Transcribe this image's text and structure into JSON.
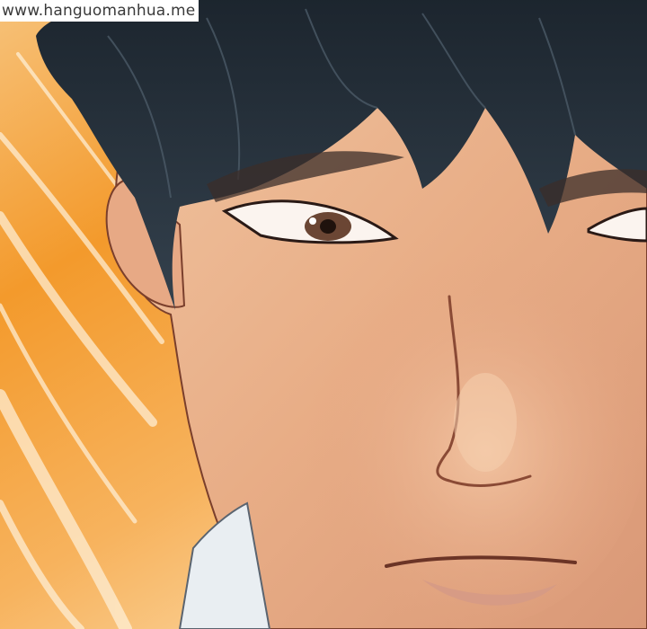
{
  "watermark": {
    "text": "www.hanguomanhua.me"
  },
  "scene": {
    "icon": "manga-face-closeup",
    "colors": {
      "background_orange": "#f39a2c",
      "background_highlight": "#fde6bf",
      "skin": "#eab38e",
      "hair": "#27323c",
      "eye_iris": "#6b4634",
      "lips": "#d59a86",
      "collar": "#e9eef2"
    }
  }
}
